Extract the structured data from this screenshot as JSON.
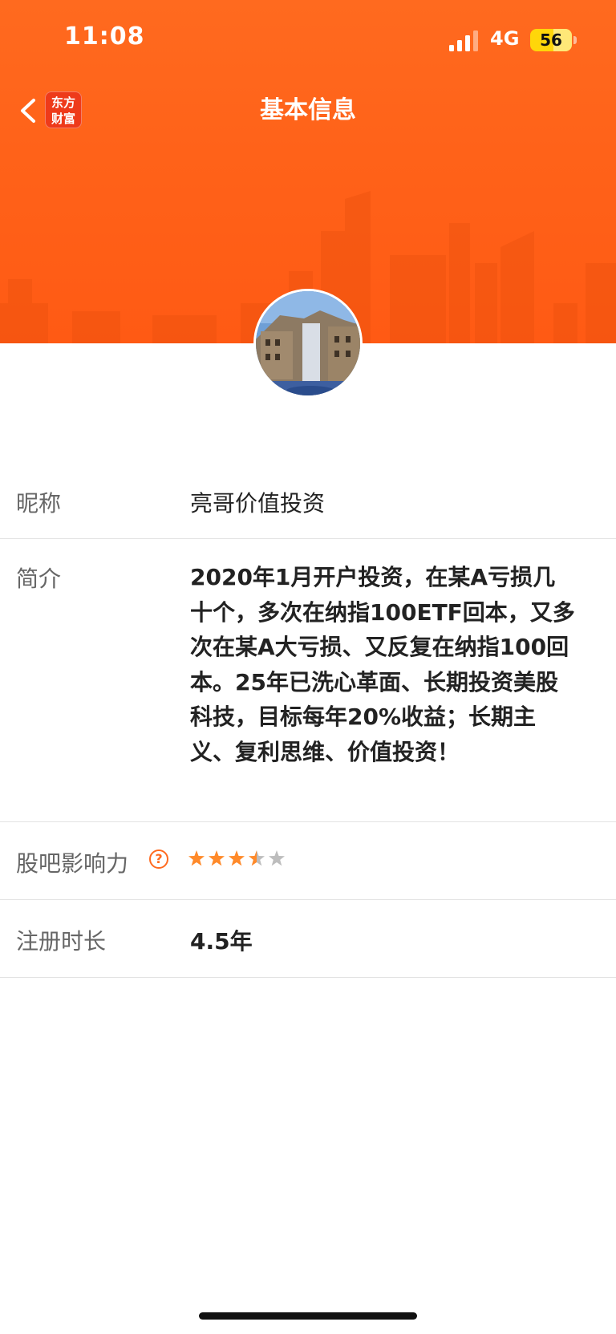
{
  "status_bar": {
    "time": "11:08",
    "network": "4G",
    "battery": "56",
    "battery_level": 0.56,
    "signal_bars_active": 3
  },
  "nav": {
    "title": "基本信息",
    "logo_text": "东方财富",
    "back_icon": "chevron-left-icon"
  },
  "colors": {
    "header_orange": "#ff6219",
    "star_active": "#ff8a2a",
    "star_inactive": "#bdbdbd",
    "help_icon": "#ff6a1f"
  },
  "profile": {
    "nickname_label": "昵称",
    "nickname": "亮哥价值投资",
    "bio_label": "简介",
    "bio": "2020年1月开户投资，在某A亏损几十个，多次在纳指100ETF回本，又多次在某A大亏损、又反复在纳指100回本。25年已洗心革面、长期投资美股科技，目标每年20%收益；长期主义、复利思维、价值投资！",
    "influence_label": "股吧影响力",
    "influence_help_icon": "question-circle-icon",
    "influence_stars": 3.5,
    "influence_max": 5,
    "reg_label": "注册时长",
    "reg_value": "4.5年"
  }
}
